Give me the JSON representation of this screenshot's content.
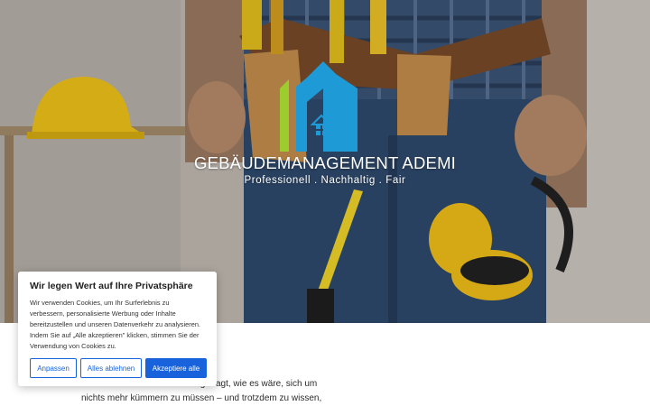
{
  "hero": {
    "brand_name": "GEBÄUDEMANAGEMENT ADEMI",
    "tagline": "Professionell . Nachhaltig . Fair"
  },
  "intro": {
    "text": "Haben Sie sich schon einmal gefragt, wie es wäre, sich um nichts mehr kümmern zu müssen – und trotzdem zu wissen,"
  },
  "cookie": {
    "title": "Wir legen Wert auf Ihre Privatsphäre",
    "text": "Wir verwenden Cookies, um Ihr Surferlebnis zu verbessern, personalisierte Werbung oder Inhalte bereitzustellen und unseren Datenverkehr zu analysieren. Indem Sie auf „Alle akzeptieren\" klicken, stimmen Sie der Verwendung von Cookies zu.",
    "customize_label": "Anpassen",
    "reject_label": "Alles ablehnen",
    "accept_label": "Akzeptiere alle"
  },
  "colors": {
    "accent": "#1863dc",
    "logo_green": "#9ccc2d",
    "logo_blue": "#1e9ad6"
  },
  "icons": [
    "house-logo-icon"
  ]
}
